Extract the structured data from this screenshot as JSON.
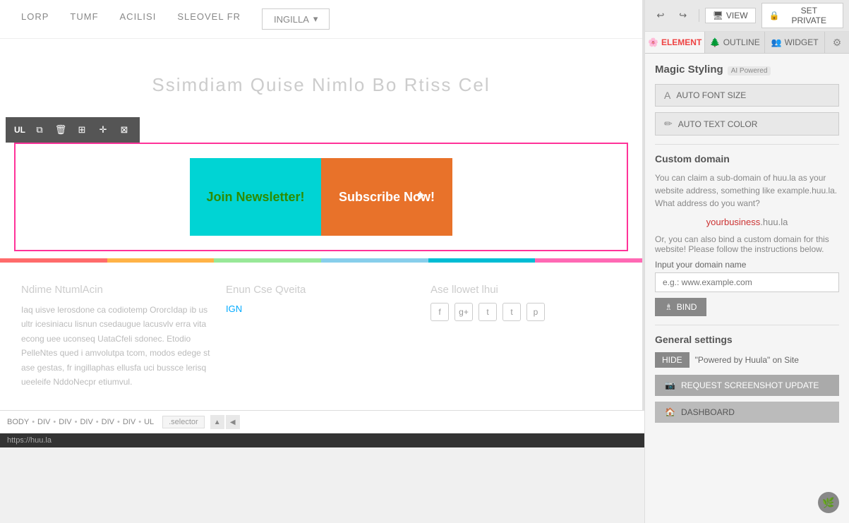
{
  "panel": {
    "tabs": [
      {
        "id": "element",
        "label": "ELEMENT",
        "icon": "🌸",
        "active": true
      },
      {
        "id": "outline",
        "label": "OUTLINE",
        "icon": "🌲"
      },
      {
        "id": "widget",
        "label": "WIDGET",
        "icon": "👥"
      }
    ],
    "settings_icon": "⚙",
    "top_toolbar": {
      "undo_title": "Undo",
      "redo_title": "Redo",
      "view_label": "VIEW",
      "private_label": "SET PRIVATE",
      "lock_icon": "🔒",
      "monitor_icon": "🖥"
    }
  },
  "magic_styling": {
    "title": "Magic Styling",
    "ai_badge": "AI Powered",
    "auto_font_size": "AUTO FONT SIZE",
    "auto_text_color": "AUTO TEXT COLOR",
    "font_icon": "A",
    "color_icon": "✏"
  },
  "custom_domain": {
    "title": "Custom domain",
    "description": "You can claim a sub-domain of huu.la as your website address, something like example.huu.la. What address do you want?",
    "domain_display_prefix": "yourbusiness",
    "domain_display_suffix": ".huu.la",
    "or_text": "Or, you can also bind a custom domain for this website! Please follow the instructions below.",
    "input_label": "Input your domain name",
    "input_placeholder": "e.g.: www.example.com",
    "bind_label": "BIND",
    "bind_icon": "♗"
  },
  "general_settings": {
    "title": "General settings",
    "hide_label": "HIDE",
    "powered_label": "\"Powered by Huula\" on Site",
    "screenshot_label": "REQUEST SCREENSHOT UPDATE",
    "screenshot_icon": "📷",
    "dashboard_label": "DASHBOARD",
    "dashboard_icon": "🏠"
  },
  "site_nav": {
    "items": [
      "LORP",
      "TUMF",
      "ACILISI",
      "SLEOVEL FR"
    ],
    "dropdown_item": "INGILLA"
  },
  "hero": {
    "title": "Ssimdiam Quise Nimlo Bo Rtiss Cel"
  },
  "cta_buttons": {
    "join": "Join Newsletter!",
    "subscribe": "Subscribe Now!"
  },
  "footer": {
    "col1_title": "Ndime NtumlAcin",
    "col1_text": "Iaq uisve lerosdone ca codiotemp OrorcIdap ib us ultr icesiniacu lisnun csedaugue lacusvlv erra vita econg uee uconseq UataCfeli sdonec. Etodio PelleNtes qued i amvolutpa tcom, modos edege st ase gestas, fr ingillaphas ellusfa uci bussce lerisq ueeleife NddoNecpr etiumvul.",
    "col2_title": "Enun Cse Qveita",
    "col2_link": "IGN",
    "col3_title": "Ase llowet lhui"
  },
  "breadcrumb": {
    "items": [
      "BODY",
      "DIV",
      "DIV",
      "DIV",
      "DIV",
      "DIV",
      "UL"
    ],
    "selector_placeholder": ".selector",
    "url": "https://huu.la"
  },
  "toolbar": {
    "ul_label": "UL",
    "buttons": [
      "copy",
      "delete",
      "grid",
      "expand",
      "tree"
    ]
  },
  "color_bar": {
    "segments": [
      "#ff6b6b",
      "#ffb347",
      "#98e898",
      "#87ceeb",
      "#00bcd4",
      "#ff69b4"
    ]
  }
}
